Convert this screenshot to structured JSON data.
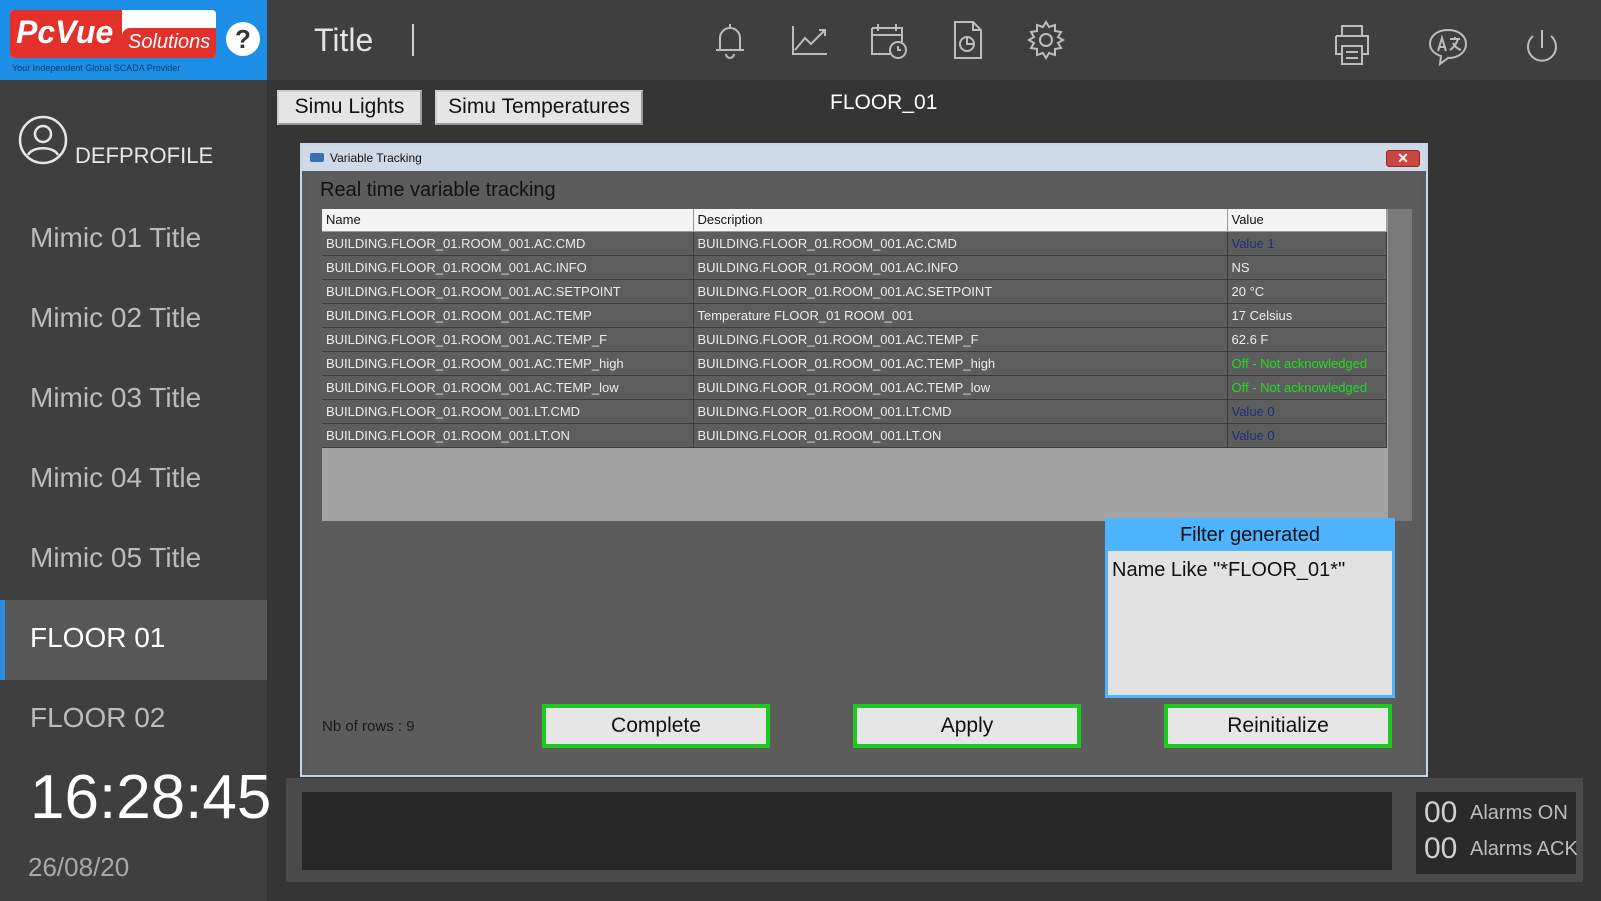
{
  "header": {
    "logo_brand": "PcVue",
    "logo_suffix": "Solutions",
    "logo_tagline": "Your Independent Global SCADA Provider",
    "help_label": "?",
    "title": "Title",
    "icons": [
      "bell-icon",
      "trend-chart-icon",
      "calendar-clock-icon",
      "report-icon",
      "gear-icon",
      "printer-icon",
      "translate-icon",
      "power-icon"
    ]
  },
  "sidebar": {
    "profile": "DEFPROFILE",
    "items": [
      {
        "label": "Mimic 01 Title"
      },
      {
        "label": "Mimic 02 Title"
      },
      {
        "label": "Mimic 03 Title"
      },
      {
        "label": "Mimic 04 Title"
      },
      {
        "label": "Mimic 05 Title"
      },
      {
        "label": "FLOOR 01"
      },
      {
        "label": "FLOOR 02"
      }
    ],
    "active_index": 5,
    "time": "16:28:45",
    "date": "26/08/20"
  },
  "main": {
    "buttons": {
      "simu_lights": "Simu Lights",
      "simu_temperatures": "Simu Temperatures"
    },
    "floor_label": "FLOOR_01"
  },
  "dialog": {
    "window_title": "Variable Tracking",
    "close_label": "✕",
    "heading": "Real time variable tracking",
    "columns": [
      "Name",
      "Description",
      "Value"
    ],
    "rows": [
      {
        "name": "BUILDING.FLOOR_01.ROOM_001.AC.CMD",
        "description": "BUILDING.FLOOR_01.ROOM_001.AC.CMD",
        "value": "Value 1",
        "status": "blue"
      },
      {
        "name": "BUILDING.FLOOR_01.ROOM_001.AC.INFO",
        "description": "BUILDING.FLOOR_01.ROOM_001.AC.INFO",
        "value": "NS",
        "status": "normal"
      },
      {
        "name": "BUILDING.FLOOR_01.ROOM_001.AC.SETPOINT",
        "description": "BUILDING.FLOOR_01.ROOM_001.AC.SETPOINT",
        "value": "20 °C",
        "status": "normal"
      },
      {
        "name": "BUILDING.FLOOR_01.ROOM_001.AC.TEMP",
        "description": "Temperature FLOOR_01 ROOM_001",
        "value": "17 Celsius",
        "status": "normal"
      },
      {
        "name": "BUILDING.FLOOR_01.ROOM_001.AC.TEMP_F",
        "description": "BUILDING.FLOOR_01.ROOM_001.AC.TEMP_F",
        "value": "62.6 F",
        "status": "normal"
      },
      {
        "name": "BUILDING.FLOOR_01.ROOM_001.AC.TEMP_high",
        "description": "BUILDING.FLOOR_01.ROOM_001.AC.TEMP_high",
        "value": "Off - Not acknowledged",
        "status": "green"
      },
      {
        "name": "BUILDING.FLOOR_01.ROOM_001.AC.TEMP_low",
        "description": "BUILDING.FLOOR_01.ROOM_001.AC.TEMP_low",
        "value": "Off - Not acknowledged",
        "status": "green"
      },
      {
        "name": "BUILDING.FLOOR_01.ROOM_001.LT.CMD",
        "description": "BUILDING.FLOOR_01.ROOM_001.LT.CMD",
        "value": "Value 0",
        "status": "blue"
      },
      {
        "name": "BUILDING.FLOOR_01.ROOM_001.LT.ON",
        "description": "BUILDING.FLOOR_01.ROOM_001.LT.ON",
        "value": "Value 0",
        "status": "blue"
      }
    ],
    "filter": {
      "heading": "Filter generated",
      "text": "Name Like \"*FLOOR_01*\""
    },
    "nb_rows": "Nb of rows : 9",
    "actions": {
      "complete": "Complete",
      "apply": "Apply",
      "reinitialize": "Reinitialize"
    }
  },
  "alarms": {
    "on_count": "00",
    "on_label": "Alarms ON",
    "ack_count": "00",
    "ack_label": "Alarms ACK"
  },
  "colors": {
    "accent": "#1c8ee6",
    "action_border": "#1ec81e",
    "filter_accent": "#4fb4ff"
  }
}
